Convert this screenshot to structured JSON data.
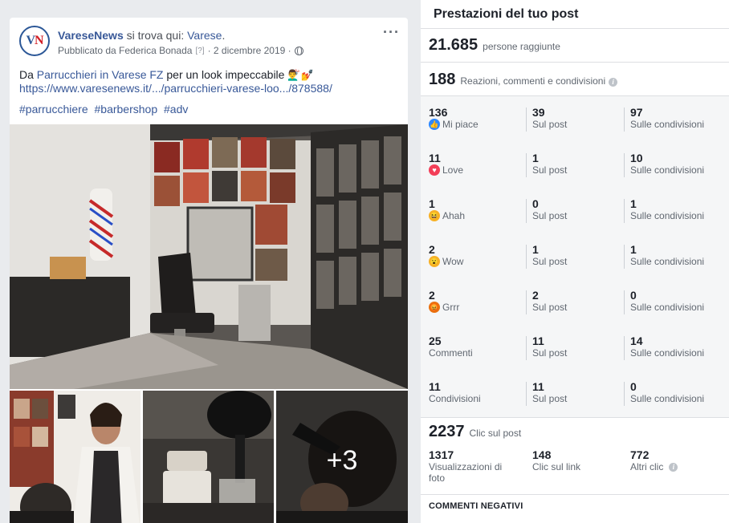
{
  "post": {
    "page_name": "VareseNews",
    "location_prefix": " si trova qui: ",
    "location": "Varese",
    "location_suffix": ".",
    "published_by": "Pubblicato da Federica Bonada",
    "help_mark": "[?]",
    "date": "· 2 dicembre 2019 ·",
    "text_prefix": "Da ",
    "text_link": "Parrucchieri in Varese FZ",
    "text_suffix": " per un look impeccabile ",
    "emoji": "💇‍♂️💅",
    "url": "https://www.varesenews.it/.../parrucchieri-varese-loo.../878588/",
    "hashtags": [
      "#parrucchiere",
      "#barbershop",
      "#adv"
    ],
    "more_photos": "+3",
    "avatar_v": "V",
    "avatar_n": "N"
  },
  "panel": {
    "title": "Prestazioni del tuo post",
    "reach_value": "21.685",
    "reach_label": "persone raggiunte",
    "engagement_value": "188",
    "engagement_label": "Reazioni, commenti e condivisioni",
    "rows": [
      {
        "c1_num": "136",
        "c1_label": "Mi piace",
        "c1_icon": "like-icon",
        "c2_num": "39",
        "c2_label": "Sul post",
        "c3_num": "97",
        "c3_label": "Sulle condivisioni"
      },
      {
        "c1_num": "11",
        "c1_label": "Love",
        "c1_icon": "love-icon",
        "c2_num": "1",
        "c2_label": "Sul post",
        "c3_num": "10",
        "c3_label": "Sulle condivisioni"
      },
      {
        "c1_num": "1",
        "c1_label": "Ahah",
        "c1_icon": "haha-icon",
        "c2_num": "0",
        "c2_label": "Sul post",
        "c3_num": "1",
        "c3_label": "Sulle condivisioni"
      },
      {
        "c1_num": "2",
        "c1_label": "Wow",
        "c1_icon": "wow-icon",
        "c2_num": "1",
        "c2_label": "Sul post",
        "c3_num": "1",
        "c3_label": "Sulle condivisioni"
      },
      {
        "c1_num": "2",
        "c1_label": "Grrr",
        "c1_icon": "angry-icon",
        "c2_num": "2",
        "c2_label": "Sul post",
        "c3_num": "0",
        "c3_label": "Sulle condivisioni"
      },
      {
        "c1_num": "25",
        "c1_label": "Commenti",
        "c2_num": "11",
        "c2_label": "Sul post",
        "c3_num": "14",
        "c3_label": "Sulle condivisioni"
      },
      {
        "c1_num": "11",
        "c1_label": "Condivisioni",
        "c2_num": "11",
        "c2_label": "Sul post",
        "c3_num": "0",
        "c3_label": "Sulle condivisioni"
      }
    ],
    "clicks_value": "2237",
    "clicks_label": "Clic sul post",
    "clicks": [
      {
        "num": "1317",
        "label": "Visualizzazioni di foto"
      },
      {
        "num": "148",
        "label": "Clic sul link"
      },
      {
        "num": "772",
        "label": "Altri clic"
      }
    ],
    "negative_title": "COMMENTI NEGATIVI"
  }
}
